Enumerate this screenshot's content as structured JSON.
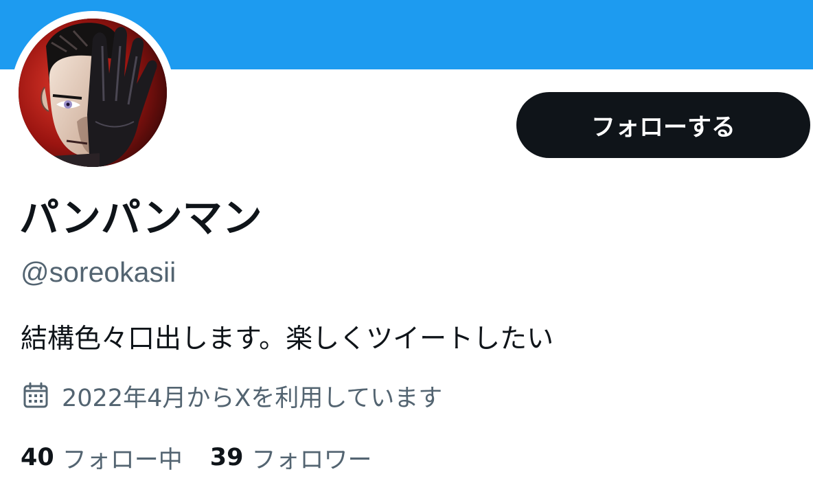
{
  "profile": {
    "display_name": "パンパンマン",
    "handle": "@soreokasii",
    "bio": "結構色々口出します。楽しくツイートしたい",
    "joined": "2022年4月からXを利用しています",
    "follow_button": "フォローする",
    "following_count": "40",
    "following_label": "フォロー中",
    "followers_count": "39",
    "followers_label": "フォロワー"
  },
  "icons": {
    "joined": "calendar-icon"
  },
  "colors": {
    "banner": "#1d9bf0",
    "button_bg": "#0f1419",
    "secondary_text": "#536471",
    "primary_text": "#0f1419"
  }
}
